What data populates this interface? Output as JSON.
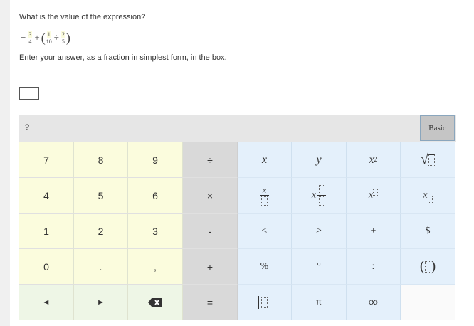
{
  "question": {
    "prompt": "What is the value of the expression?",
    "expression": {
      "minus": "−",
      "f1_num": "3",
      "f1_den": "4",
      "plus": "+",
      "open_paren": "(",
      "f2_num": "1",
      "f2_den": "10",
      "divide": "÷",
      "f3_num": "2",
      "f3_den": "5",
      "close_paren": ")"
    },
    "instruction": "Enter your answer, as a fraction in simplest form, in the box.",
    "answer_value": ""
  },
  "keypad": {
    "help_label": "?",
    "mode_label": "Basic",
    "keys": {
      "k7": "7",
      "k8": "8",
      "k9": "9",
      "divide": "÷",
      "k4": "4",
      "k5": "5",
      "k6": "6",
      "times": "×",
      "k1": "1",
      "k2": "2",
      "k3": "3",
      "minus": "-",
      "k0": "0",
      "decimal": ".",
      "comma": ",",
      "plus": "+",
      "left": "◄",
      "right": "►",
      "equals": "=",
      "x": "x",
      "y": "y",
      "x2_base": "x",
      "x2_exp": "2",
      "sqrt": "√",
      "frac_x": "x",
      "mixed_x": "x",
      "pow_x": "x",
      "sub_x": "x",
      "lt": "<",
      "gt": ">",
      "pm": "±",
      "dollar": "$",
      "percent": "%",
      "degree": "°",
      "ratio": ":",
      "paren_l": "(",
      "paren_r": ")",
      "pi": "π",
      "infinity": "∞"
    },
    "icons": {
      "backspace": "backspace-icon",
      "abs": "absolute-value-icon"
    }
  }
}
